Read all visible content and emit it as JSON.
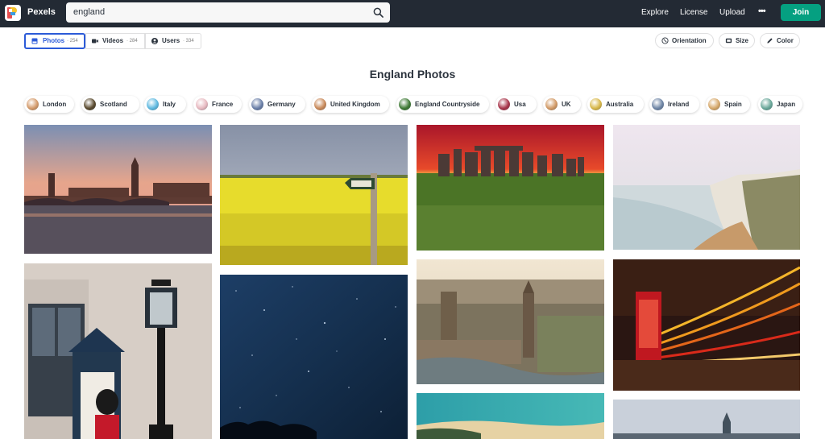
{
  "header": {
    "brand": "Pexels",
    "search_value": "england",
    "nav": [
      "Explore",
      "License",
      "Upload"
    ],
    "more": "•••",
    "join": "Join"
  },
  "tabs": [
    {
      "label": "Photos",
      "count": "· 254",
      "active": true,
      "icon": "image-icon"
    },
    {
      "label": "Videos",
      "count": "· 284",
      "active": false,
      "icon": "video-icon"
    },
    {
      "label": "Users",
      "count": "· 334",
      "active": false,
      "icon": "user-icon"
    }
  ],
  "filters": [
    {
      "label": "Orientation",
      "icon": "orientation-icon"
    },
    {
      "label": "Size",
      "icon": "size-icon"
    },
    {
      "label": "Color",
      "icon": "color-icon"
    }
  ],
  "page_title": "England Photos",
  "chips": [
    {
      "label": "London",
      "color": "#d49a6a"
    },
    {
      "label": "Scotland",
      "color": "#5a4a2e"
    },
    {
      "label": "Italy",
      "color": "#5fb9e0"
    },
    {
      "label": "France",
      "color": "#e7b9c0"
    },
    {
      "label": "Germany",
      "color": "#6a7fa8"
    },
    {
      "label": "United Kingdom",
      "color": "#c98a5a"
    },
    {
      "label": "England Countryside",
      "color": "#3f7a35"
    },
    {
      "label": "Usa",
      "color": "#a8354a"
    },
    {
      "label": "UK",
      "color": "#d29a66"
    },
    {
      "label": "Australia",
      "color": "#d8b84a"
    },
    {
      "label": "Ireland",
      "color": "#6f86a6"
    },
    {
      "label": "Spain",
      "color": "#d6a86a"
    },
    {
      "label": "Japan",
      "color": "#6aa89a"
    }
  ],
  "photos": [
    {
      "name": "photo-london-thames-sunset",
      "colors": [
        "#c98a7a",
        "#5a4a5a"
      ]
    },
    {
      "name": "photo-rapeseed-field-footpath-sign",
      "colors": [
        "#9aa6b8",
        "#e0d82a"
      ]
    },
    {
      "name": "photo-stonehenge-sunset",
      "colors": [
        "#d24a2a",
        "#4f7a2a"
      ]
    },
    {
      "name": "photo-white-cliffs-coast",
      "colors": [
        "#e8e2e8",
        "#8a8a6a"
      ]
    },
    {
      "name": "photo-royal-guard-lamp-post",
      "colors": [
        "#d8d0c8",
        "#2a2a2a"
      ]
    },
    {
      "name": "photo-starry-night-sky",
      "colors": [
        "#1a3a62",
        "#0a1e3a"
      ]
    },
    {
      "name": "photo-westminster-aerial",
      "colors": [
        "#d8cab0",
        "#7a6a58"
      ]
    },
    {
      "name": "photo-red-phone-box-light-trails",
      "colors": [
        "#e8a62a",
        "#8a1a1a"
      ]
    },
    {
      "name": "photo-turquoise-beach",
      "colors": [
        "#3ab0b0",
        "#2a6a7a"
      ]
    },
    {
      "name": "photo-big-ben-dusk",
      "colors": [
        "#c8d0dc",
        "#4a5a6a"
      ]
    }
  ]
}
